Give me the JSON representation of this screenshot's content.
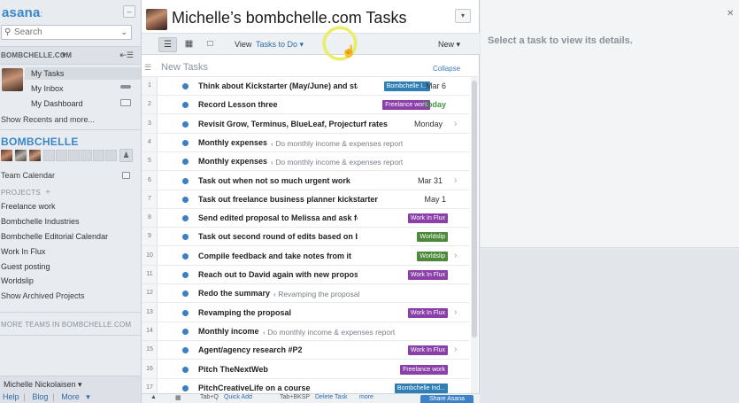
{
  "sidebar": {
    "logo": "asana",
    "logo_dots": ":",
    "search": {
      "placeholder": "Search"
    },
    "workspace": "BOMBCHELLE.COM",
    "nav": [
      {
        "label": "My Tasks"
      },
      {
        "label": "My Inbox"
      },
      {
        "label": "My Dashboard"
      }
    ],
    "show_recents": "Show Recents and more...",
    "team": "BOMBCHELLE",
    "team_calendar": "Team Calendar",
    "projects_header": "PROJECTS",
    "projects": [
      "Freelance work",
      "Bombchelle Industries",
      "Bombchelle Editorial Calendar",
      "Work In Flux",
      "Guest posting",
      "Worldslip"
    ],
    "show_archived": "Show Archived Projects",
    "more_teams": "MORE TEAMS IN BOMBCHELLE.COM",
    "user": {
      "name": "Michelle Nickolaisen",
      "help": "Help",
      "blog": "Blog",
      "more": "More"
    }
  },
  "center": {
    "title": "Michelle’s bombchelle.com Tasks",
    "view_label": "View",
    "view_value": "Tasks to Do",
    "new_label": "New",
    "section": "New Tasks",
    "collapse": "Collapse",
    "tasks": [
      {
        "n": "1",
        "name": "Think about Kickstarter (May/June) and star",
        "tag": "Bombchelle I...",
        "tag_color": "#2f7fb5",
        "due": "Mar 6",
        "today": false,
        "arrow": false,
        "parent": ""
      },
      {
        "n": "2",
        "name": "Record Lesson three",
        "tag": "Freelance work",
        "tag_color": "#8b3fa9",
        "due": "Today",
        "today": true,
        "arrow": false,
        "parent": ""
      },
      {
        "n": "3",
        "name": "Revisit Grow, Terminus, BlueLeaf, Projecturf rates",
        "tag": "",
        "tag_color": "",
        "due": "Monday",
        "today": false,
        "arrow": true,
        "parent": ""
      },
      {
        "n": "4",
        "name": "Monthly expenses",
        "tag": "",
        "tag_color": "",
        "due": "",
        "today": false,
        "arrow": false,
        "parent": "‹ Do monthly income & expenses report"
      },
      {
        "n": "5",
        "name": "Monthly expenses",
        "tag": "",
        "tag_color": "",
        "due": "",
        "today": false,
        "arrow": false,
        "parent": "‹ Do monthly income & expenses report"
      },
      {
        "n": "6",
        "name": "Task out when not so much urgent work",
        "tag": "",
        "tag_color": "",
        "due": "Mar 31",
        "today": false,
        "arrow": true,
        "parent": ""
      },
      {
        "n": "7",
        "name": "Task out freelance business planner kickstarter",
        "tag": "",
        "tag_color": "",
        "due": "May 1",
        "today": false,
        "arrow": false,
        "parent": ""
      },
      {
        "n": "8",
        "name": "Send edited proposal to Melissa and ask for input",
        "tag": "Work In Flux",
        "tag_color": "#8b3fa9",
        "due": "",
        "today": false,
        "arrow": false,
        "parent": ""
      },
      {
        "n": "9",
        "name": "Task out second round of edits based on beta reader fe",
        "tag": "Worldslip",
        "tag_color": "#4c8a3a",
        "due": "",
        "today": false,
        "arrow": false,
        "parent": ""
      },
      {
        "n": "10",
        "name": "Compile feedback and take notes from it",
        "tag": "Worldslip",
        "tag_color": "#4c8a3a",
        "due": "",
        "today": false,
        "arrow": true,
        "parent": ""
      },
      {
        "n": "11",
        "name": "Reach out to David again with new proposal/angle",
        "tag": "Work In Flux",
        "tag_color": "#8b3fa9",
        "due": "",
        "today": false,
        "arrow": false,
        "parent": ""
      },
      {
        "n": "12",
        "name": "Redo the summary",
        "tag": "",
        "tag_color": "",
        "due": "",
        "today": false,
        "arrow": false,
        "parent": "‹ Revamping the proposal"
      },
      {
        "n": "13",
        "name": "Revamping the proposal",
        "tag": "Work In Flux",
        "tag_color": "#8b3fa9",
        "due": "",
        "today": false,
        "arrow": true,
        "parent": ""
      },
      {
        "n": "14",
        "name": "Monthly income",
        "tag": "",
        "tag_color": "",
        "due": "",
        "today": false,
        "arrow": false,
        "parent": "‹ Do monthly income & expenses report"
      },
      {
        "n": "15",
        "name": "Agent/agency research #P2",
        "tag": "Work In Flux",
        "tag_color": "#8b3fa9",
        "due": "",
        "today": false,
        "arrow": true,
        "parent": ""
      },
      {
        "n": "16",
        "name": "Pitch TheNextWeb",
        "tag": "Freelance work",
        "tag_color": "#8b3fa9",
        "due": "",
        "today": false,
        "arrow": false,
        "parent": ""
      },
      {
        "n": "17",
        "name": "PitchCreativeLife on a course",
        "tag": "Bombchelle Ind...",
        "tag_color": "#2f7fb5",
        "due": "",
        "today": false,
        "arrow": false,
        "parent": ""
      }
    ],
    "footer": {
      "tab_label": "Tab+Q",
      "quick_add": "Quick Add",
      "tab_bksp": "Tab+BKSP",
      "delete_task": "Delete Task",
      "more": "more",
      "share": "Share Asana"
    }
  },
  "details": {
    "message": "Select a task to view its details."
  },
  "colors": {
    "accent": "#3a87c8",
    "task_dot": "#3d7fc4",
    "today": "#3c9c3c",
    "tag_purple": "#8b3fa9",
    "tag_blue": "#2f7fb5",
    "tag_green": "#4c8a3a"
  },
  "icons": {
    "search": "search-icon",
    "list_view": "list-icon",
    "calendar_view": "calendar-icon",
    "files_view": "files-icon",
    "task_arrow": "chevron-right-icon"
  }
}
